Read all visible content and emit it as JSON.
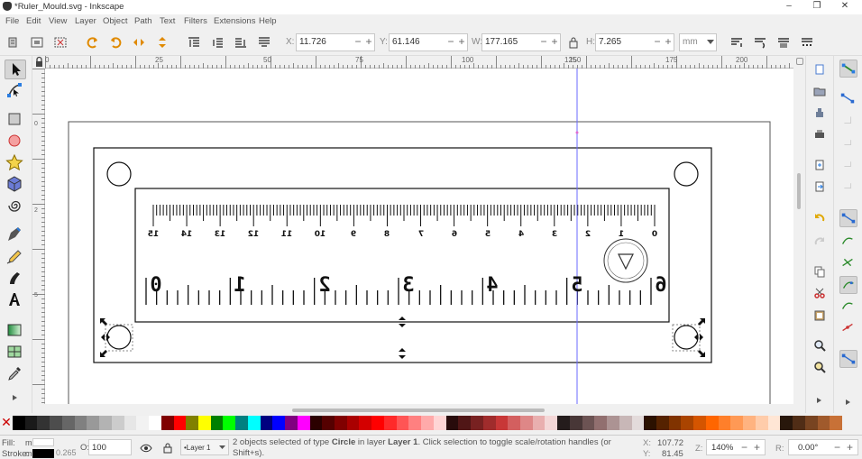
{
  "window": {
    "title": "*Ruler_Mould.svg - Inkscape",
    "minimize": "–",
    "maximize": "❐",
    "close": "✕"
  },
  "menu": [
    "File",
    "Edit",
    "View",
    "Layer",
    "Object",
    "Path",
    "Text",
    "Filters",
    "Extensions",
    "Help"
  ],
  "toolbar": {
    "x_label": "X:",
    "x_value": "11.726",
    "y_label": "Y:",
    "y_value": "61.146",
    "w_label": "W:",
    "w_value": "177.165",
    "h_label": "H:",
    "h_value": "7.265",
    "unit": "mm",
    "minus": "−",
    "plus": "+"
  },
  "ruler": {
    "h_labels": [
      "0",
      "25",
      "50",
      "75",
      "100",
      "125",
      "150",
      "175",
      "200"
    ],
    "v_labels": [
      "0",
      "2",
      "5"
    ]
  },
  "document": {
    "ruler_small_numbers": [
      "0",
      "1",
      "2",
      "3",
      "4",
      "5",
      "6",
      "7",
      "8",
      "9",
      "10",
      "11",
      "12",
      "13",
      "14",
      "15"
    ],
    "ruler_big_numbers": [
      "0",
      "1",
      "2",
      "3",
      "4",
      "5",
      "6"
    ]
  },
  "palette": {
    "none_swatch": "✕",
    "colors": [
      "#000000",
      "#1a1a1a",
      "#333333",
      "#4d4d4d",
      "#666666",
      "#808080",
      "#999999",
      "#b3b3b3",
      "#cccccc",
      "#e6e6e6",
      "#f2f2f2",
      "#ffffff",
      "#800000",
      "#ff0000",
      "#808000",
      "#ffff00",
      "#008000",
      "#00ff00",
      "#008080",
      "#00ffff",
      "#000080",
      "#0000ff",
      "#800080",
      "#ff00ff",
      "#2b0000",
      "#550000",
      "#800000",
      "#aa0000",
      "#d40000",
      "#ff0000",
      "#ff2a2a",
      "#ff5555",
      "#ff8080",
      "#ffaaaa",
      "#ffd5d5",
      "#280b0b",
      "#501616",
      "#782121",
      "#a02c2c",
      "#c83737",
      "#d35f5f",
      "#de8787",
      "#e9afaf",
      "#f4d7d7",
      "#241c1c",
      "#483737",
      "#6c5353",
      "#916f6f",
      "#ac9393",
      "#c8b7b7",
      "#e3dbdb",
      "#2b1100",
      "#552200",
      "#803300",
      "#aa4400",
      "#d45500",
      "#ff6600",
      "#ff7f2a",
      "#ff9955",
      "#ffb380",
      "#ffccaa",
      "#ffe6d5",
      "#28170b",
      "#502d16",
      "#784421",
      "#a05a2c",
      "#c87137"
    ]
  },
  "status": {
    "fill_label": "Fill:",
    "fill_value": "m",
    "stroke_label": "Stroke:",
    "stroke_value": "m",
    "stroke_width": "0.265",
    "opacity_label": "O:",
    "opacity_value": "100",
    "layer": "•Layer 1",
    "message_pre": "2 objects selected of type ",
    "message_type": "Circle",
    "message_mid": " in layer ",
    "message_layer": "Layer 1",
    "message_post": ". Click selection to toggle scale/rotation handles (or Shift+s).",
    "x_label": "X:",
    "x_value": "107.72",
    "y_label": "Y:",
    "y_value": "81.45",
    "z_label": "Z:",
    "zoom": "140%",
    "r_label": "R:",
    "rotation": "0.00°"
  }
}
